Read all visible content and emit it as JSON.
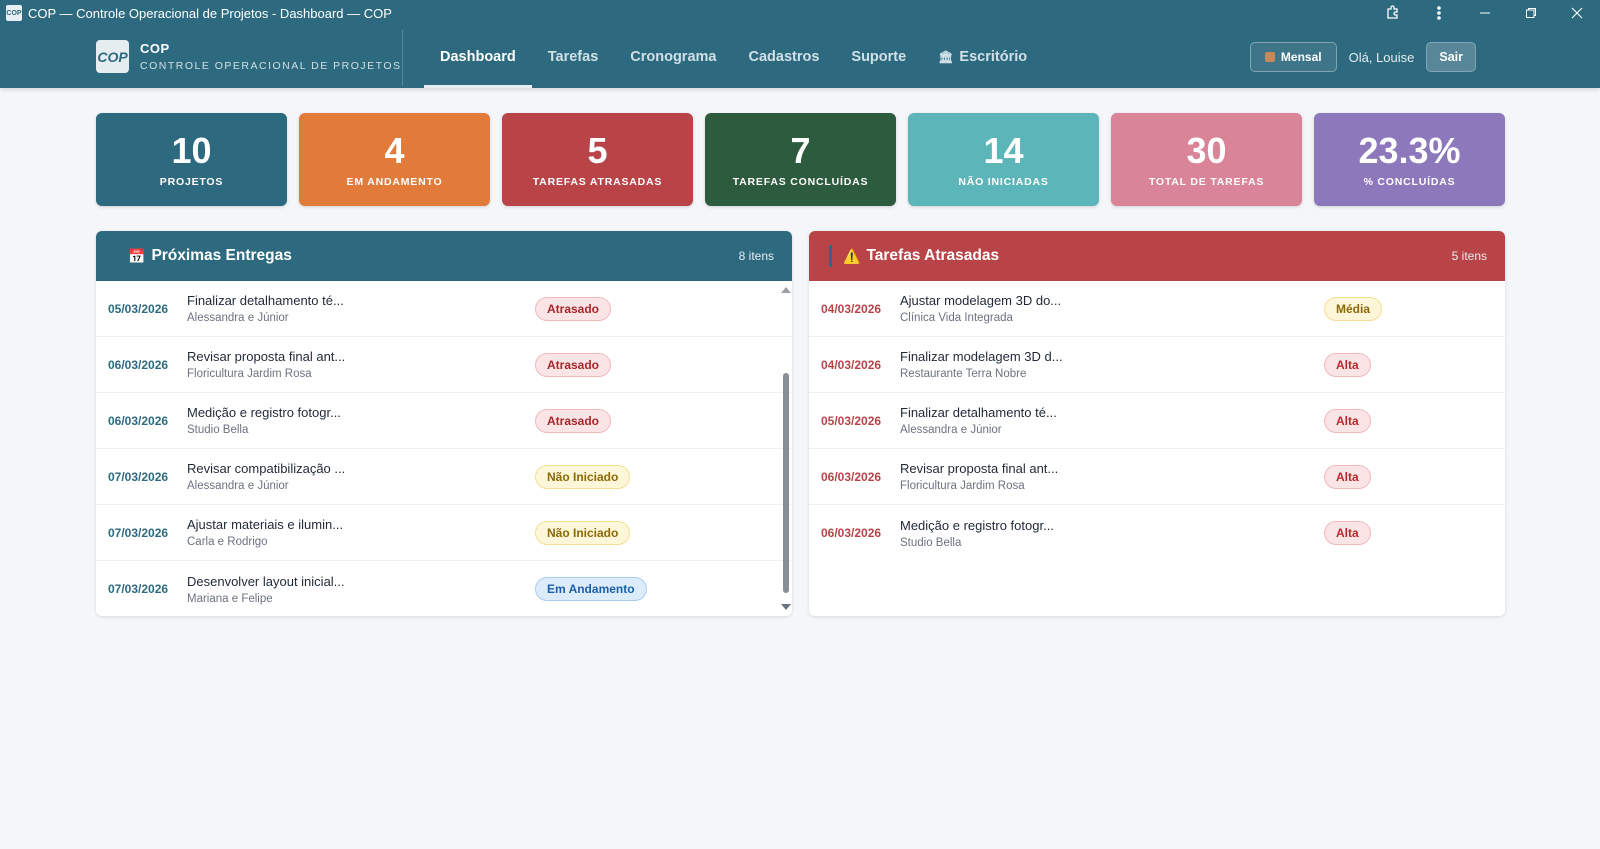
{
  "window": {
    "title": "COP — Controle Operacional de Projetos - Dashboard — COP",
    "icon_text": "COP"
  },
  "brand": {
    "logo_text": "COP",
    "name": "COP",
    "subtitle": "CONTROLE OPERACIONAL DE PROJETOS"
  },
  "nav": {
    "items": [
      {
        "label": "Dashboard",
        "active": true
      },
      {
        "label": "Tarefas",
        "active": false
      },
      {
        "label": "Cronograma",
        "active": false
      },
      {
        "label": "Cadastros",
        "active": false
      },
      {
        "label": "Suporte",
        "active": false
      },
      {
        "label": "Escritório",
        "active": false
      }
    ]
  },
  "header_right": {
    "period_label": "Mensal",
    "greeting": "Olá, Louise",
    "logout_label": "Sair"
  },
  "stats": [
    {
      "value": "10",
      "label": "PROJETOS",
      "color": "#2e6a7f"
    },
    {
      "value": "4",
      "label": "EM ANDAMENTO",
      "color": "#e27b39"
    },
    {
      "value": "5",
      "label": "TAREFAS ATRASADAS",
      "color": "#b84448"
    },
    {
      "value": "7",
      "label": "TAREFAS CONCLUÍDAS",
      "color": "#2d5b3d"
    },
    {
      "value": "14",
      "label": "NÃO INICIADAS",
      "color": "#5cb5b8"
    },
    {
      "value": "30",
      "label": "TOTAL DE TAREFAS",
      "color": "#d98497"
    },
    {
      "value": "23.3%",
      "label": "% CONCLUÍDAS",
      "color": "#8d78bb"
    }
  ],
  "proximas": {
    "title": "Próximas Entregas",
    "count": "8 itens",
    "rows": [
      {
        "date": "05/03/2026",
        "title": "Finalizar detalhamento té...",
        "subtitle": "Alessandra e Júnior",
        "status": "Atrasado"
      },
      {
        "date": "06/03/2026",
        "title": "Revisar proposta final ant...",
        "subtitle": "Floricultura Jardim Rosa",
        "status": "Atrasado"
      },
      {
        "date": "06/03/2026",
        "title": "Medição e registro fotogr...",
        "subtitle": "Studio Bella",
        "status": "Atrasado"
      },
      {
        "date": "07/03/2026",
        "title": "Revisar compatibilização ...",
        "subtitle": "Alessandra e Júnior",
        "status": "Não Iniciado"
      },
      {
        "date": "07/03/2026",
        "title": "Ajustar materiais e ilumin...",
        "subtitle": "Carla e Rodrigo",
        "status": "Não Iniciado"
      },
      {
        "date": "07/03/2026",
        "title": "Desenvolver layout inicial...",
        "subtitle": "Mariana e Felipe",
        "status": "Em Andamento"
      }
    ]
  },
  "atrasadas": {
    "title": "Tarefas Atrasadas",
    "count": "5 itens",
    "rows": [
      {
        "date": "04/03/2026",
        "title": "Ajustar modelagem 3D do...",
        "subtitle": "Clínica Vida Integrada",
        "priority": "Média"
      },
      {
        "date": "04/03/2026",
        "title": "Finalizar modelagem 3D d...",
        "subtitle": "Restaurante Terra Nobre",
        "priority": "Alta"
      },
      {
        "date": "05/03/2026",
        "title": "Finalizar detalhamento té...",
        "subtitle": "Alessandra e Júnior",
        "priority": "Alta"
      },
      {
        "date": "06/03/2026",
        "title": "Revisar proposta final ant...",
        "subtitle": "Floricultura Jardim Rosa",
        "priority": "Alta"
      },
      {
        "date": "06/03/2026",
        "title": "Medição e registro fotogr...",
        "subtitle": "Studio Bella",
        "priority": "Alta"
      }
    ]
  }
}
